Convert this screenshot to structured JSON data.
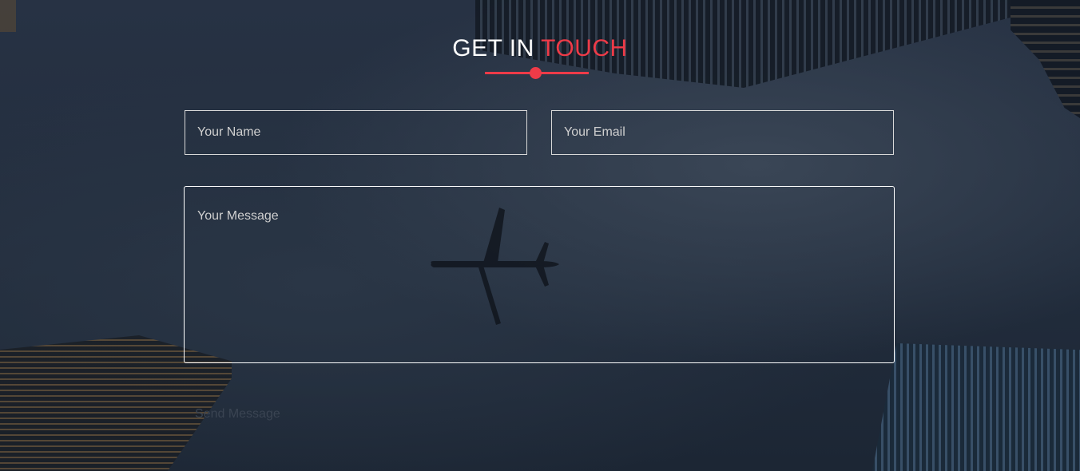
{
  "heading": {
    "part1": "GET IN ",
    "part2": "TOUCH",
    "accent_color": "#ee3b48"
  },
  "form": {
    "name_placeholder": "Your Name",
    "email_placeholder": "Your Email",
    "message_placeholder": "Your Message",
    "send_label": "Send Message"
  }
}
